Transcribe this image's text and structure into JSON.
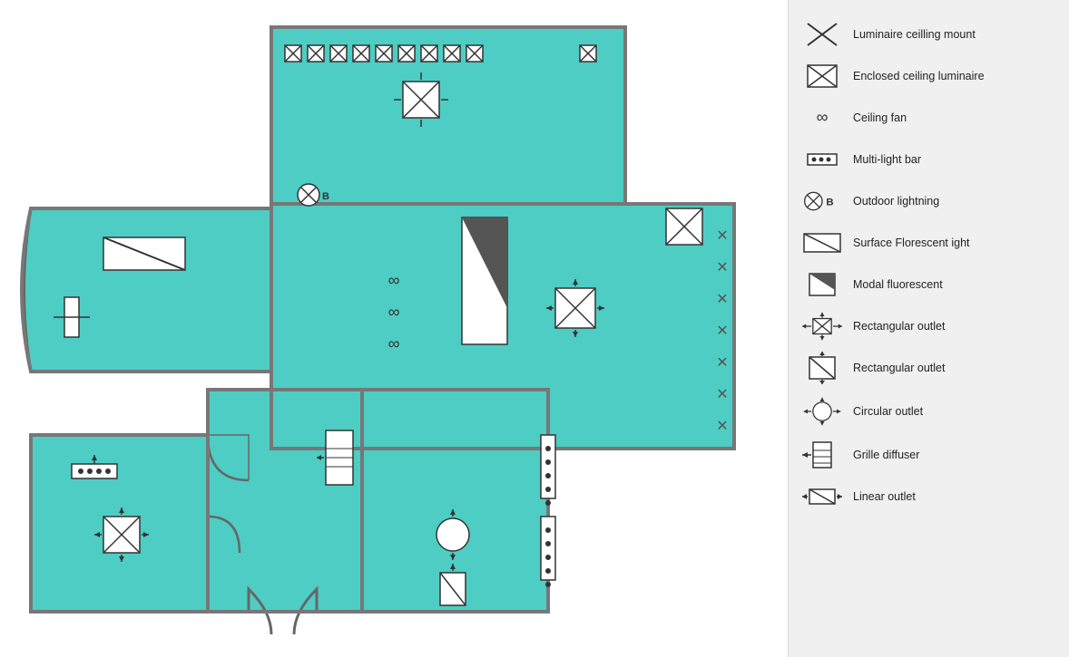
{
  "legend": {
    "items": [
      {
        "id": "luminaire-ceiling-mount",
        "label": "Luminaire ceilling mount",
        "icon": "x-box"
      },
      {
        "id": "enclosed-ceiling-luminaire",
        "label": "Enclosed ceiling luminaire",
        "icon": "x-box-enclosed"
      },
      {
        "id": "ceiling-fan",
        "label": "Ceiling fan",
        "icon": "infinity"
      },
      {
        "id": "multi-light-bar",
        "label": "Multi-light bar",
        "icon": "multi-bar"
      },
      {
        "id": "outdoor-lightning",
        "label": "Outdoor lightning",
        "icon": "outdoor"
      },
      {
        "id": "surface-florescent",
        "label": "Surface Florescent ight",
        "icon": "surface"
      },
      {
        "id": "modal-fluorescent",
        "label": "Modal fluorescent",
        "icon": "modal"
      },
      {
        "id": "rectangular-outlet-1",
        "label": "Rectangular outlet",
        "icon": "rect-outlet-arrows"
      },
      {
        "id": "rectangular-outlet-2",
        "label": "Rectangular outlet",
        "icon": "rect-outlet-slash"
      },
      {
        "id": "circular-outlet",
        "label": "Circular outlet",
        "icon": "circle-outlet"
      },
      {
        "id": "grille-diffuser",
        "label": "Grille diffuser",
        "icon": "grille"
      },
      {
        "id": "linear-outlet",
        "label": "Linear outlet",
        "icon": "linear"
      }
    ]
  }
}
